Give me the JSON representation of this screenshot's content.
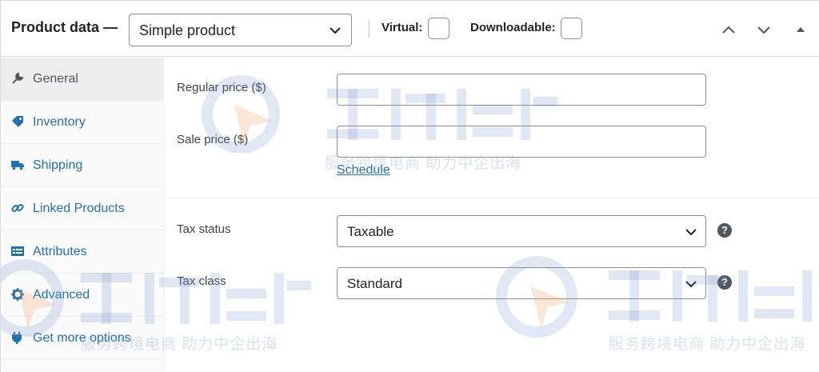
{
  "header": {
    "title": "Product data —",
    "product_type": "Simple product",
    "virtual_label": "Virtual:",
    "downloadable_label": "Downloadable:"
  },
  "tabs": [
    {
      "label": "General",
      "icon": "wrench-icon",
      "active": true
    },
    {
      "label": "Inventory",
      "icon": "tag-icon",
      "active": false
    },
    {
      "label": "Shipping",
      "icon": "truck-icon",
      "active": false
    },
    {
      "label": "Linked Products",
      "icon": "link-icon",
      "active": false
    },
    {
      "label": "Attributes",
      "icon": "list-icon",
      "active": false
    },
    {
      "label": "Advanced",
      "icon": "gear-icon",
      "active": false
    },
    {
      "label": "Get more options",
      "icon": "plugin-icon",
      "active": false
    }
  ],
  "general": {
    "regular_price_label": "Regular price ($)",
    "regular_price_value": "",
    "sale_price_label": "Sale price ($)",
    "sale_price_value": "",
    "schedule_link": "Schedule",
    "tax_status_label": "Tax status",
    "tax_status_value": "Taxable",
    "tax_class_label": "Tax class",
    "tax_class_value": "Standard",
    "help_glyph": "?"
  },
  "watermark": {
    "caption": "服务跨境电商  助力中企出海"
  },
  "colors": {
    "link": "#2271b1",
    "border": "#8c8f94"
  }
}
